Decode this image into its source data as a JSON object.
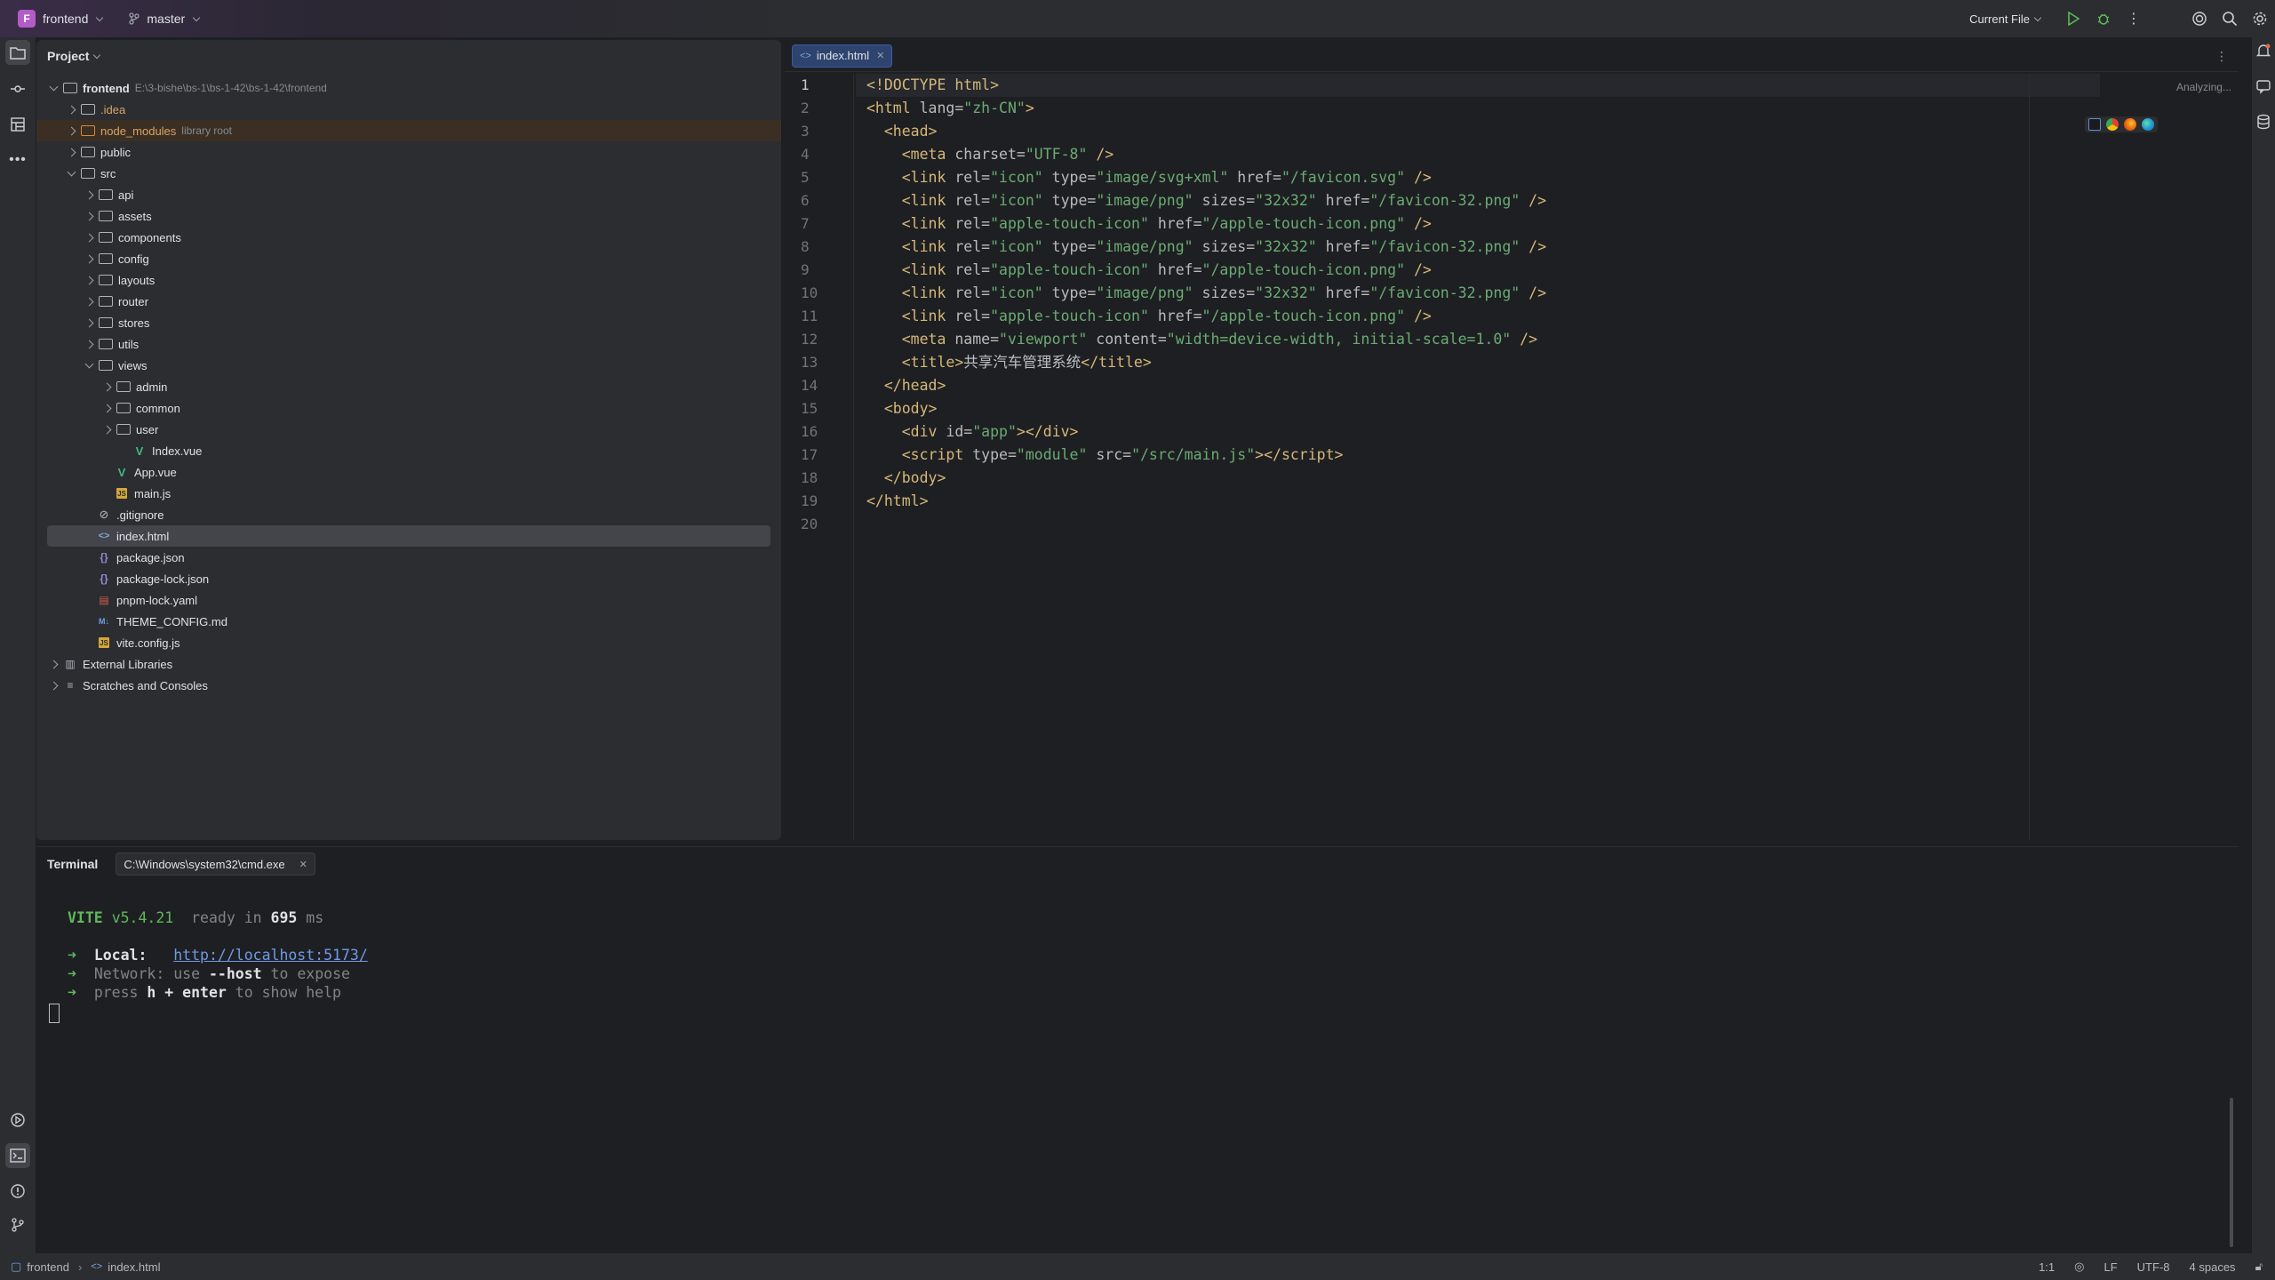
{
  "titlebar": {
    "project_badge": "F",
    "project_name": "frontend",
    "branch": "master",
    "run_config": "Current File"
  },
  "project_panel": {
    "title": "Project",
    "tree": [
      {
        "label": "frontend",
        "path": "E:\\3-bishe\\bs-1\\bs-1-42\\bs-1-42\\frontend",
        "type": "root"
      },
      {
        "label": ".idea",
        "type": "folder"
      },
      {
        "label": "node_modules",
        "note": "library root",
        "type": "folder"
      },
      {
        "label": "public",
        "type": "folder"
      },
      {
        "label": "src",
        "type": "folder"
      },
      {
        "label": "api",
        "type": "folder"
      },
      {
        "label": "assets",
        "type": "folder"
      },
      {
        "label": "components",
        "type": "folder"
      },
      {
        "label": "config",
        "type": "folder"
      },
      {
        "label": "layouts",
        "type": "folder"
      },
      {
        "label": "router",
        "type": "folder"
      },
      {
        "label": "stores",
        "type": "folder"
      },
      {
        "label": "utils",
        "type": "folder"
      },
      {
        "label": "views",
        "type": "folder"
      },
      {
        "label": "admin",
        "type": "folder"
      },
      {
        "label": "common",
        "type": "folder"
      },
      {
        "label": "user",
        "type": "folder"
      },
      {
        "label": "Index.vue",
        "type": "vue"
      },
      {
        "label": "App.vue",
        "type": "vue"
      },
      {
        "label": "main.js",
        "type": "js"
      },
      {
        "label": ".gitignore",
        "type": "git"
      },
      {
        "label": "index.html",
        "type": "html"
      },
      {
        "label": "package.json",
        "type": "json"
      },
      {
        "label": "package-lock.json",
        "type": "json"
      },
      {
        "label": "pnpm-lock.yaml",
        "type": "yaml"
      },
      {
        "label": "THEME_CONFIG.md",
        "type": "md"
      },
      {
        "label": "vite.config.js",
        "type": "js"
      },
      {
        "label": "External Libraries",
        "type": "lib"
      },
      {
        "label": "Scratches and Consoles",
        "type": "scratch"
      }
    ]
  },
  "editor": {
    "tab_label": "index.html",
    "status": "Analyzing...",
    "line_numbers": [
      "1",
      "2",
      "3",
      "4",
      "5",
      "6",
      "7",
      "8",
      "9",
      "10",
      "11",
      "12",
      "13",
      "14",
      "15",
      "16",
      "17",
      "18",
      "19",
      "20"
    ],
    "title_text": "共享汽车管理系统"
  },
  "terminal": {
    "title": "Terminal",
    "tab_label": "C:\\Windows\\system32\\cmd.exe",
    "vite_name": "VITE",
    "vite_version": "v5.4.21",
    "ready_text": "ready in",
    "ready_ms": "695",
    "ms_unit": "ms",
    "local_label": "Local:",
    "local_url": "http://localhost:5173/",
    "network_label": "Network:",
    "network_text_1": "use",
    "network_flag": "--host",
    "network_text_2": "to expose",
    "press_text": "press",
    "press_keys": "h + enter",
    "press_text_2": "to show help"
  },
  "statusbar": {
    "breadcrumb_project": "frontend",
    "breadcrumb_file": "index.html",
    "position": "1:1",
    "line_ending": "LF",
    "encoding": "UTF-8",
    "indent": "4 spaces"
  }
}
